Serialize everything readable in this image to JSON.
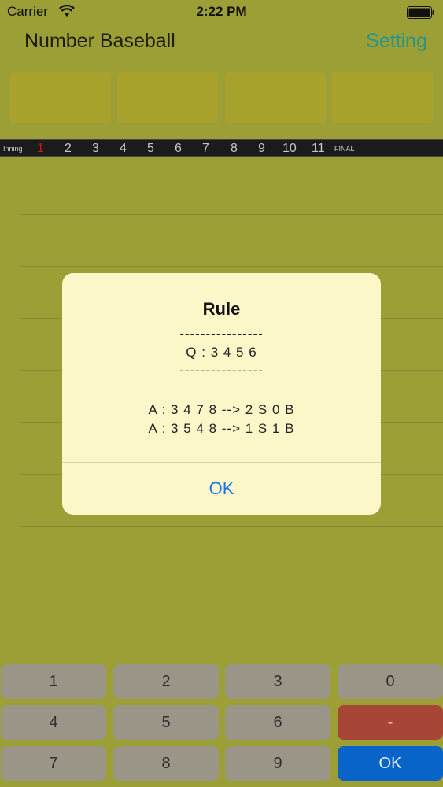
{
  "status": {
    "carrier": "Carrier",
    "time": "2:22 PM"
  },
  "nav": {
    "title": "Number Baseball",
    "setting": "Setting"
  },
  "inning": {
    "label": "Inning",
    "numbers": [
      "1",
      "2",
      "3",
      "4",
      "5",
      "6",
      "7",
      "8",
      "9",
      "10",
      "11"
    ],
    "final": "FINAL"
  },
  "dialog": {
    "title": "Rule",
    "dashes": "----------------",
    "question": "Q : 3 4 5 6",
    "example1": "A : 3 4 7 8 --> 2 S 0 B",
    "example2": "A : 3 5 4 8 --> 1 S 1 B",
    "ok": "OK"
  },
  "keypad": {
    "k1": "1",
    "k2": "2",
    "k3": "3",
    "k0": "0",
    "k4": "4",
    "k5": "5",
    "k6": "6",
    "minus": "-",
    "k7": "7",
    "k8": "8",
    "k9": "9",
    "ok": "OK"
  },
  "colors": {
    "background": "#9c9f35",
    "accent_setting": "#23958c",
    "ok_key": "#0964c9",
    "minus_key": "#a74636"
  }
}
